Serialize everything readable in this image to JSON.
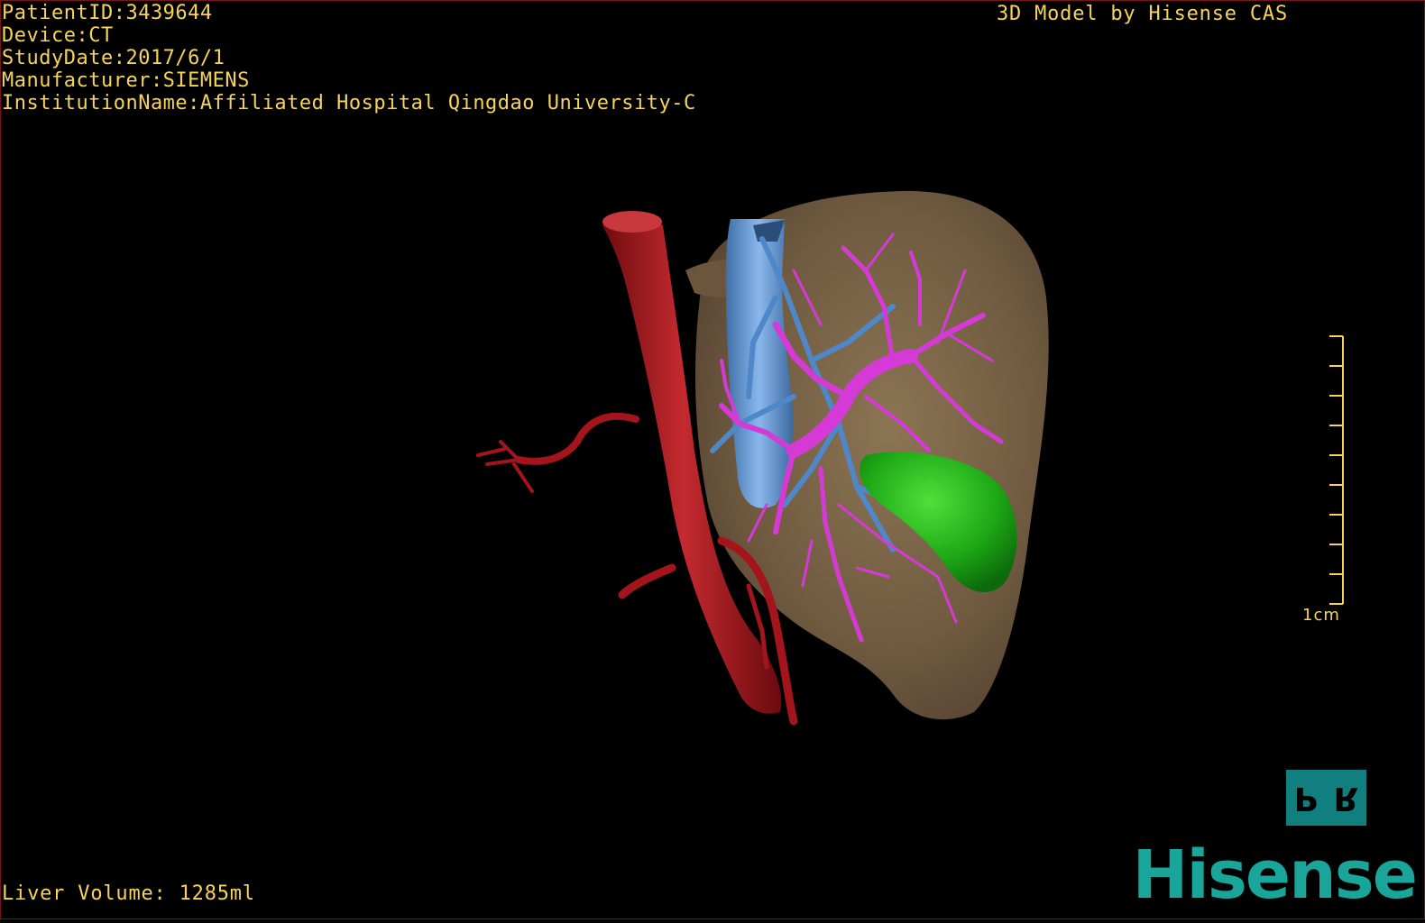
{
  "overlay": {
    "patient_id": "PatientID:3439644",
    "device": "Device:CT",
    "study_date": "StudyDate:2017/6/1",
    "manufacturer": "Manufacturer:SIEMENS",
    "institution": "InstitutionName:Affiliated Hospital Qingdao University-C",
    "credit": "3D Model by Hisense CAS",
    "volume": "Liver Volume: 1285ml"
  },
  "scale_bar": {
    "label": "1cm"
  },
  "orientation": {
    "left_letter": "P",
    "right_letter": "R"
  },
  "brand": {
    "logo_text": "Hisense"
  },
  "colors": {
    "overlay_text": "#f5d45a",
    "liver": "#7b6548",
    "aorta": "#a4151b",
    "vena_cava": "#6f9fd8",
    "portal_vein": "#d63ad6",
    "gallbladder": "#22a81a",
    "brand": "#19a59a",
    "orientation_cube": "#117f80"
  }
}
